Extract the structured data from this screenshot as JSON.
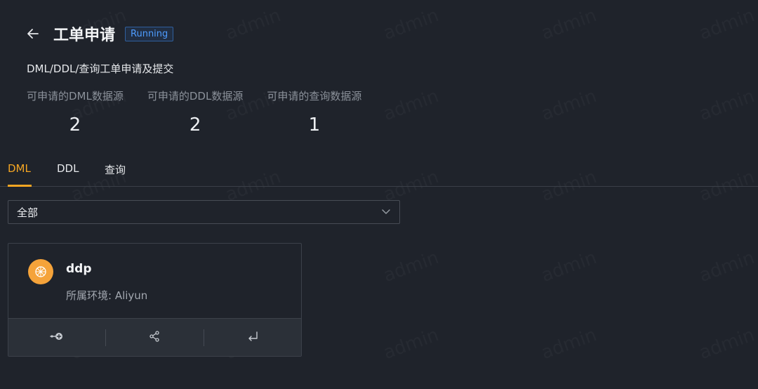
{
  "header": {
    "title": "工单申请",
    "status": "Running"
  },
  "description": "DML/DDL/查询工单申请及提交",
  "stats": [
    {
      "label": "可申请的DML数据源",
      "value": "2"
    },
    {
      "label": "可申请的DDL数据源",
      "value": "2"
    },
    {
      "label": "可申请的查询数据源",
      "value": "1"
    }
  ],
  "tabs": [
    {
      "label": "DML",
      "active": true
    },
    {
      "label": "DDL",
      "active": false
    },
    {
      "label": "查询",
      "active": false
    }
  ],
  "filter": {
    "value": "全部"
  },
  "cards": [
    {
      "name": "ddp",
      "environment": "所属环境: Aliyun",
      "avatar_icon": "database-icon",
      "actions": [
        "key-add-icon",
        "share-icon",
        "enter-icon"
      ]
    }
  ],
  "watermark": "admin",
  "colors": {
    "accent": "#f5a623",
    "badge": "#4e9cff",
    "background": "#1f232b"
  }
}
